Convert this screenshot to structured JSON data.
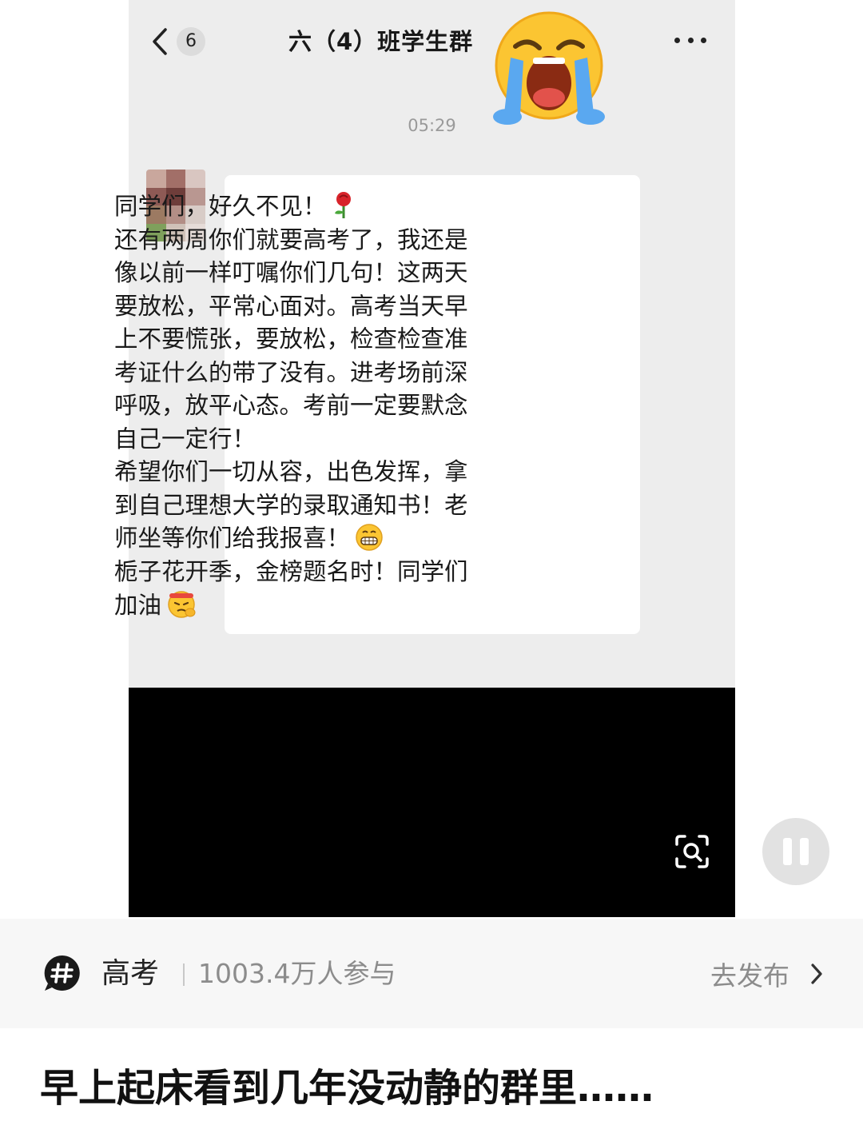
{
  "chat": {
    "unread_count": "6",
    "title": "六（4）班学生群",
    "timestamp": "05:29",
    "message_lines": [
      "同学们，好久不见！",
      "还有两周你们就要高考了，我还是",
      "像以前一样叮嘱你们几句！这两天",
      "要放松，平常心面对。高考当天早",
      "上不要慌张，要放松，检查检查准",
      "考证什么的带了没有。进考场前深",
      "呼吸，放平心态。考前一定要默念",
      "自己一定行！",
      "希望你们一切从容，出色发挥，拿",
      "到自己理想大学的录取通知书！老",
      "师坐等你们给我报喜！",
      "栀子花开季，金榜题名时！同学们",
      "加油"
    ],
    "inline_emojis": [
      "rose-icon",
      "grin-emoji-icon",
      "fighting-emoji-icon"
    ],
    "overlay_emoji": "loudly-crying-emoji-icon"
  },
  "video": {
    "zoom_icon": "zoom-scan-icon",
    "pause_icon": "pause-icon"
  },
  "topic": {
    "icon": "hashtag-icon",
    "name": "高考",
    "participants": "1003.4万人参与",
    "publish_label": "去发布"
  },
  "caption": "早上起床看到几年没动静的群里……",
  "colors": {
    "chat_background": "#ededed",
    "bubble": "#ffffff",
    "video_area": "#000000",
    "topic_bar": "#f7f7f7"
  }
}
